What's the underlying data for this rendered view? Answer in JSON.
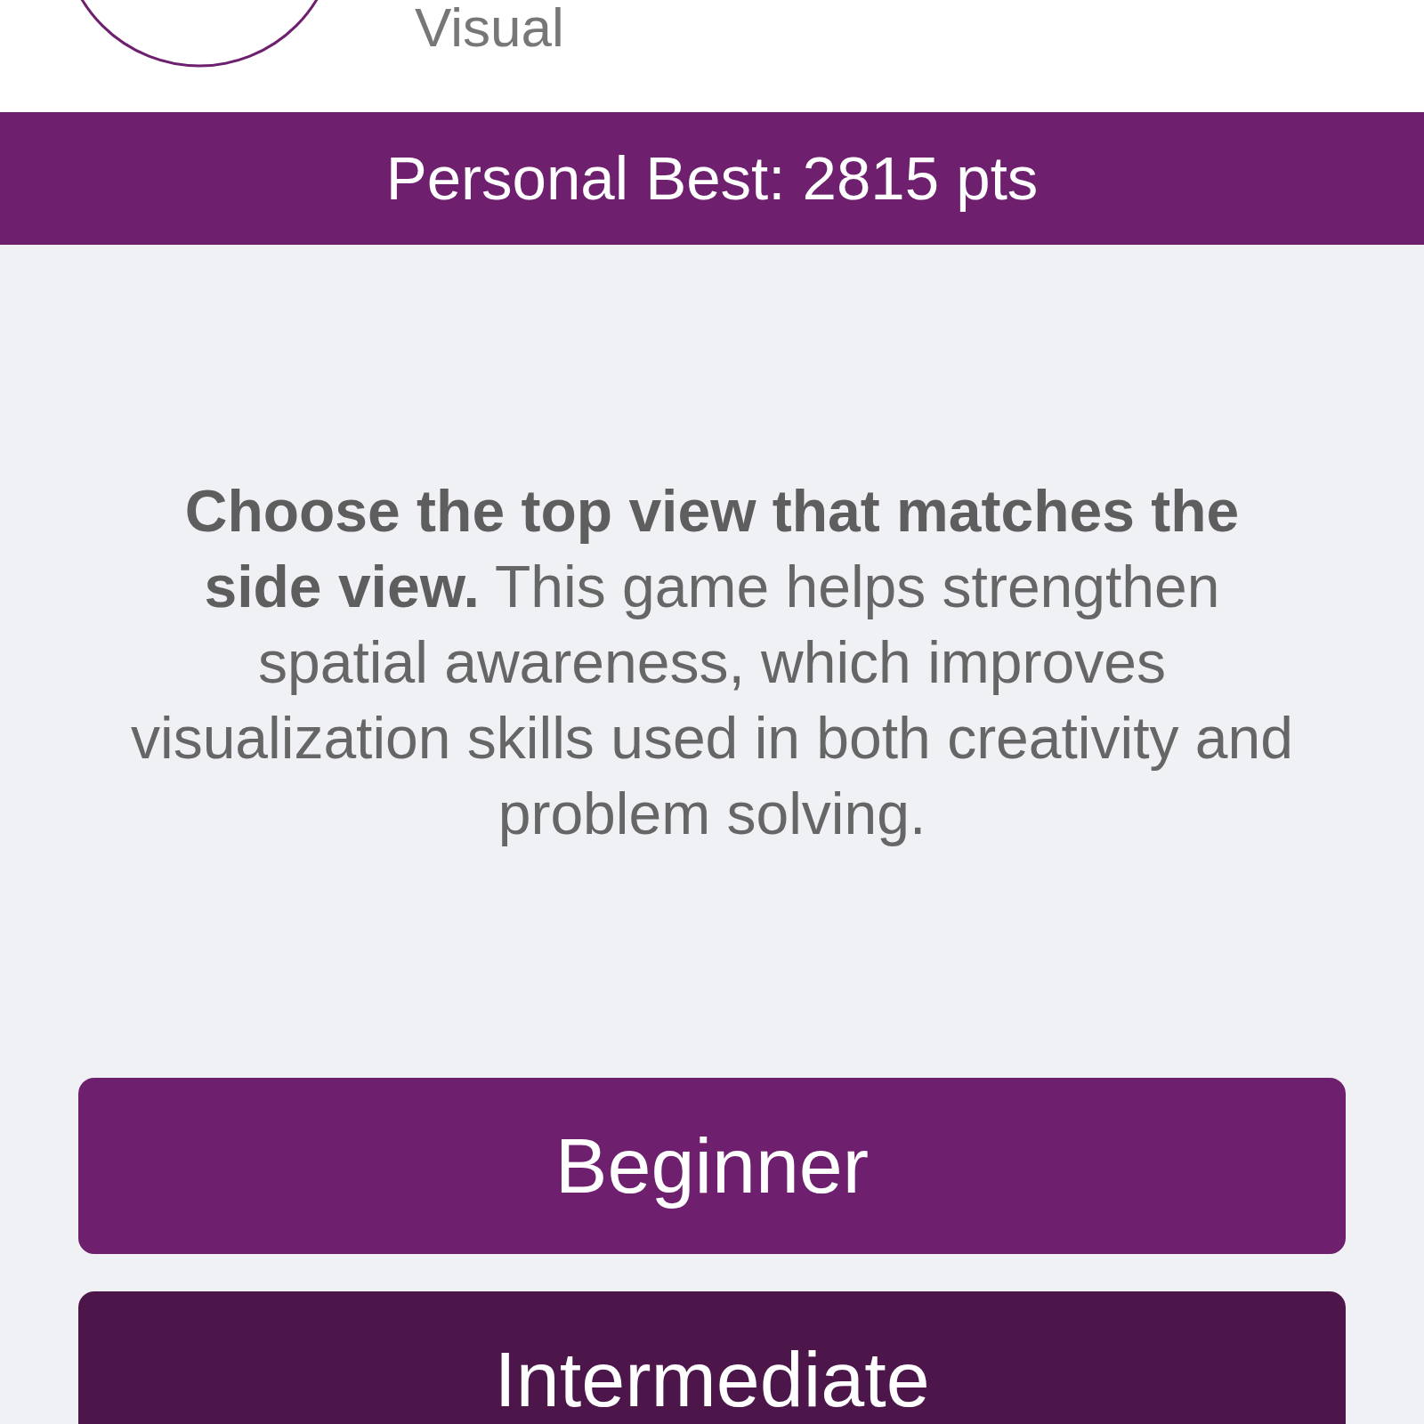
{
  "header": {
    "text": "Visual"
  },
  "score_bar": {
    "text": "Personal Best: 2815 pts"
  },
  "description": "**Choose the top view that matches the side view.** This game helps strengthen spatial awareness, which improves visualization skills used in both creativity and problem solving.",
  "level_buttons": [
    {
      "label": "Beginner",
      "color": "#6e1f6e"
    },
    {
      "label": "Intermediate",
      "color": "#4d164a"
    }
  ]
}
